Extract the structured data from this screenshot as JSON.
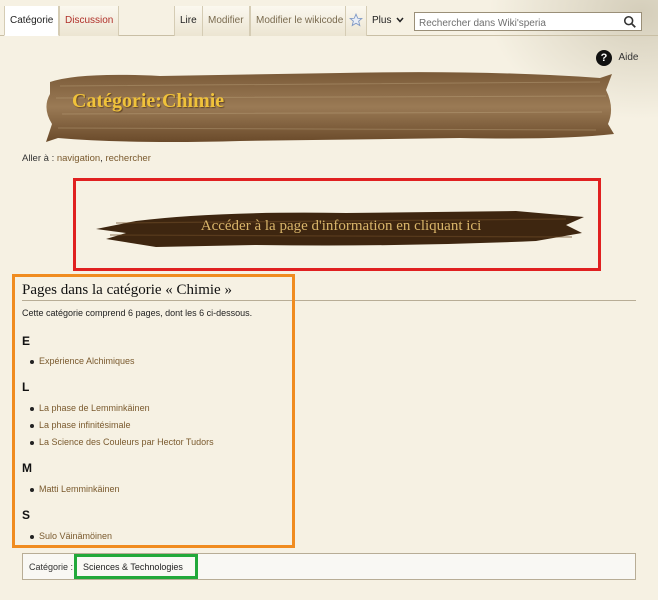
{
  "tabs": {
    "category": "Catégorie",
    "discussion": "Discussion",
    "read": "Lire",
    "edit": "Modifier",
    "edit_wikicode": "Modifier le wikicode",
    "more": "Plus"
  },
  "search": {
    "placeholder": "Rechercher dans Wiki'speria"
  },
  "help": {
    "label": "Aide"
  },
  "page_title": "Catégorie:Chimie",
  "jump": {
    "prefix": "Aller à :",
    "navigation": "navigation",
    "separator": ",",
    "search": "rechercher"
  },
  "info_banner": {
    "text": "Accéder à la page d'information en cliquant ici"
  },
  "category_pages": {
    "heading": "Pages dans la catégorie « Chimie »",
    "count_text": "Cette catégorie comprend 6 pages, dont les 6 ci-dessous.",
    "groups": [
      {
        "letter": "E",
        "items": [
          "Expérience Alchimiques"
        ]
      },
      {
        "letter": "L",
        "items": [
          "La phase de Lemminkäinen",
          "La phase infinitésimale",
          "La Science des Couleurs par Hector Tudors"
        ]
      },
      {
        "letter": "M",
        "items": [
          "Matti Lemminkäinen"
        ]
      },
      {
        "letter": "S",
        "items": [
          "Sulo Väinämöinen"
        ]
      }
    ]
  },
  "catlinks": {
    "label": "Catégorie :",
    "link": "Sciences & Technologies"
  },
  "colors": {
    "title_gold": "#f0c23a",
    "brush_brown": "#5c3a1c",
    "highlight_red": "#e02020",
    "highlight_orange": "#f08c20",
    "highlight_green": "#22a83a",
    "link_brown": "#7a5a2e",
    "discussion_red": "#b0302a"
  },
  "icons": {
    "watch": "star-icon",
    "search": "magnifier-icon",
    "help": "question-mark-icon",
    "more": "chevron-down-icon"
  }
}
